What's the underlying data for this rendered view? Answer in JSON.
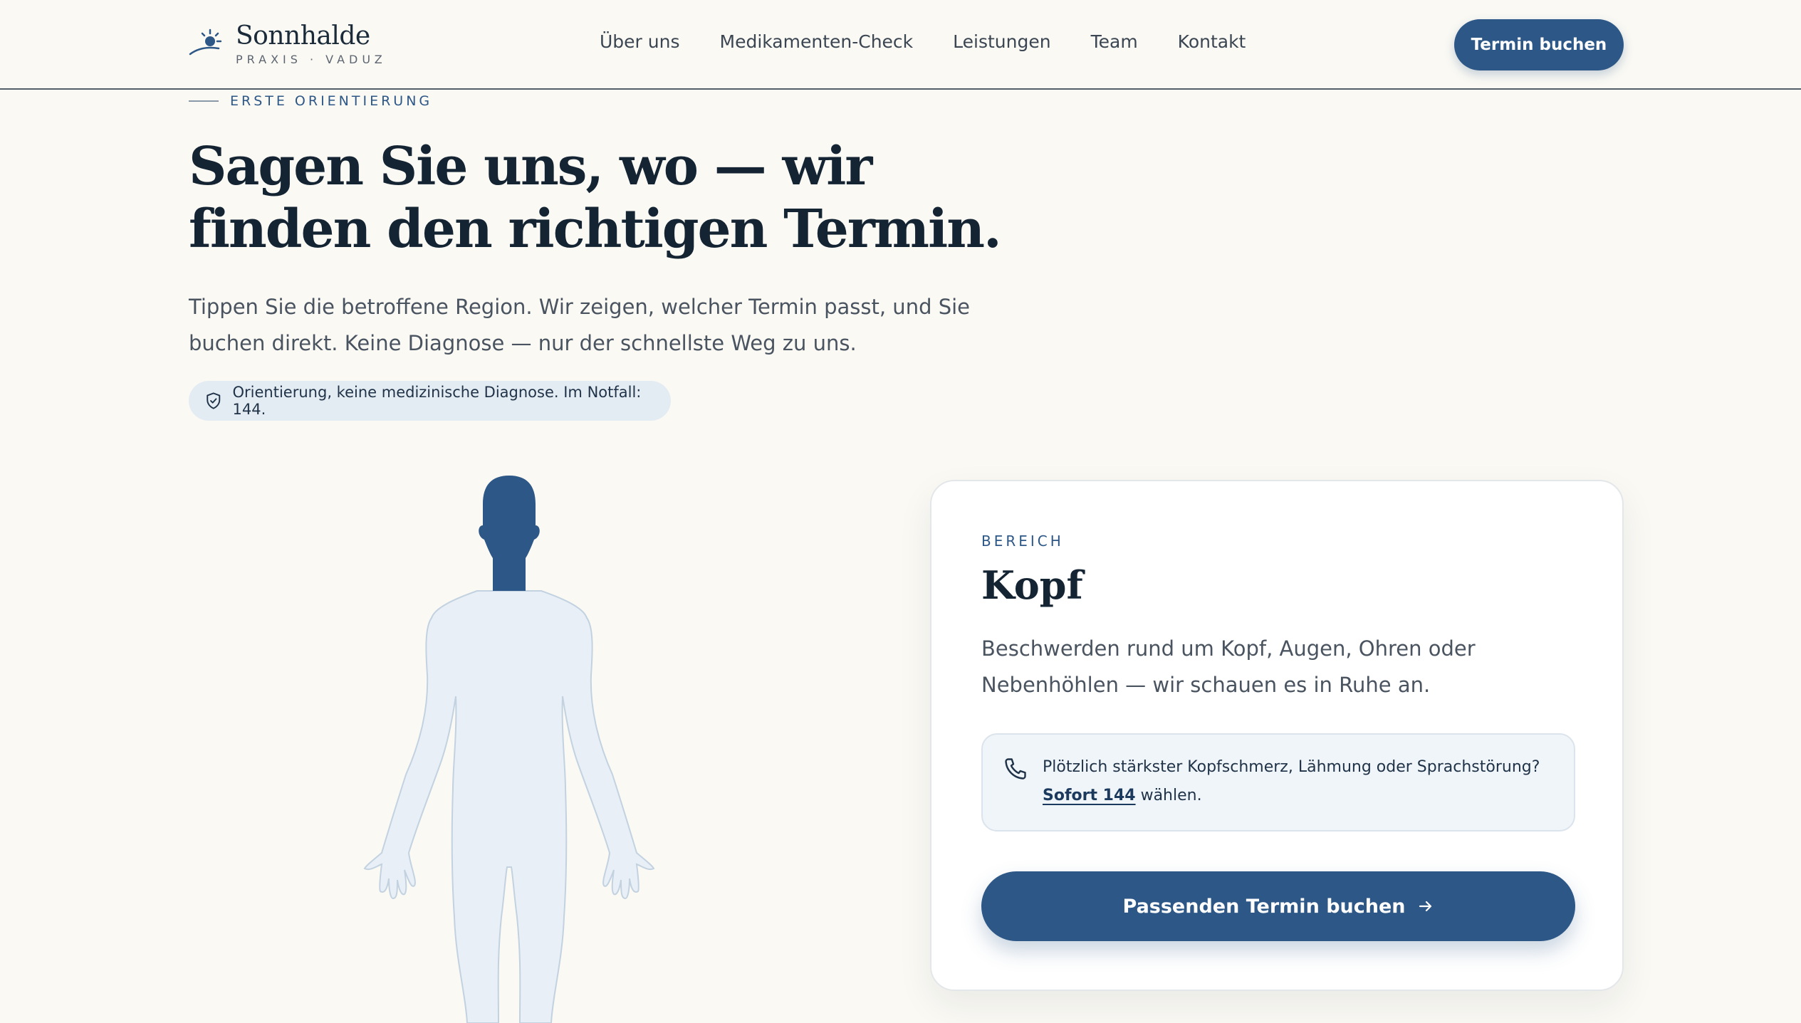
{
  "brand": {
    "name": "Sonnhalde",
    "tagline": "PRAXIS · VADUZ"
  },
  "nav": {
    "items": [
      {
        "label": "Über uns"
      },
      {
        "label": "Medikamenten-Check"
      },
      {
        "label": "Leistungen"
      },
      {
        "label": "Team"
      },
      {
        "label": "Kontakt"
      }
    ],
    "cta_label": "Termin buchen"
  },
  "hero": {
    "eyebrow": "ERSTE ORIENTIERUNG",
    "title_line1": "Sagen Sie uns, wo — wir",
    "title_line2": "finden den richtigen Termin.",
    "lead": "Tippen Sie die betroffene Region. Wir zeigen, welcher Termin passt, und Sie buchen direkt. Keine Diagnose — nur der schnellste Weg zu uns.",
    "notice": "Orientierung, keine medizinische Diagnose. Im Notfall: 144."
  },
  "body_map": {
    "selected_region": "Kopf",
    "colors": {
      "selected": "#2d5786",
      "unselected": "#e8eff6",
      "outline": "#c3d2e0"
    }
  },
  "card": {
    "eyebrow": "BEREICH",
    "title": "Kopf",
    "description": "Beschwerden rund um Kopf, Augen, Ohren oder Nebenhöhlen — wir schauen es in Ruhe an.",
    "alert_text": "Plötzlich stärkster Kopfschmerz, Lähmung oder Sprachstörung?",
    "alert_link": "Sofort 144",
    "alert_suffix": " wählen.",
    "cta_label": "Passenden Termin buchen"
  },
  "icons": {
    "logo": "sun-icon",
    "notice": "shield-icon",
    "alert": "phone-icon",
    "cta": "arrow-right-icon"
  },
  "theme": {
    "accent": "#2d5786",
    "background": "#faf9f4",
    "text": "#142433"
  }
}
